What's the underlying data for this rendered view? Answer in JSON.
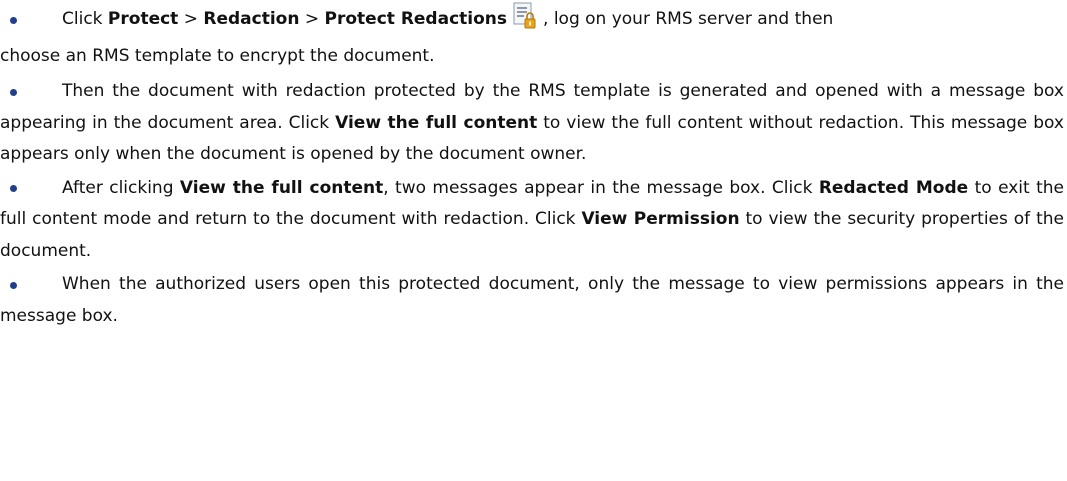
{
  "bullets": [
    {
      "click": "Click ",
      "protect": "Protect",
      "sep1": " > ",
      "redaction": "Redaction",
      "sep2": " > ",
      "protect_redactions": "Protect Redactions",
      "icon": "protect-redactions-icon",
      "after_icon": ", log on your RMS server and then",
      "line2": "choose an RMS template to encrypt the document."
    },
    {
      "text1": "Then the document with redaction protected by the RMS template is generated and opened with a message box appearing in the document area. Click ",
      "bold1": "View the full content",
      "text2": " to view the full content without redaction. This message box appears only when the document is opened by the document owner."
    },
    {
      "text1": "After clicking ",
      "bold1": "View the full content",
      "text2": ", two messages appear in the message box. Click ",
      "bold2": "Redacted Mode",
      "text3": " to exit the full content mode and return to the document with redaction. Click ",
      "bold3": "View Permission",
      "text4": " to view the security properties of the document."
    },
    {
      "text1": "When the authorized users open this protected document, only the message to view permissions appears in the message box."
    }
  ],
  "colors": {
    "bullet": "#1f3f8c",
    "text": "#111111",
    "icon_lock": "#e8a317"
  }
}
